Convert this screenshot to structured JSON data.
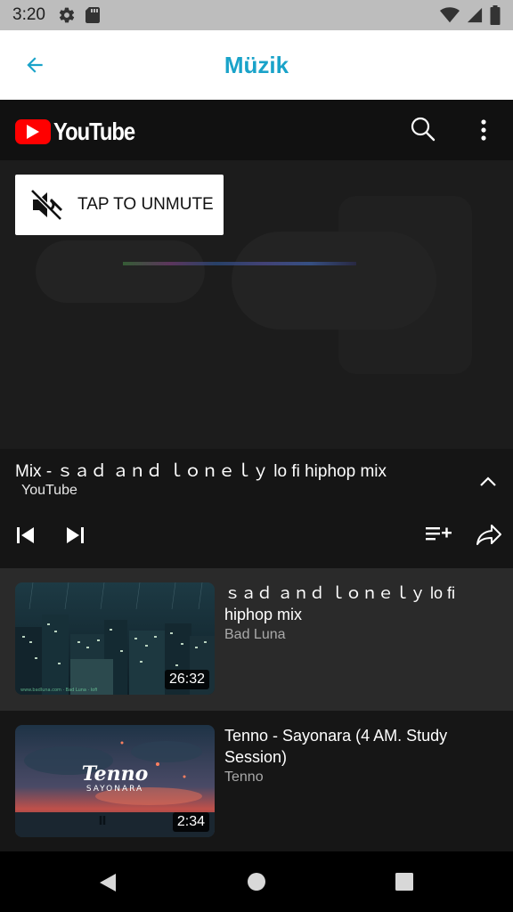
{
  "status_bar": {
    "time": "3:20",
    "left_icons": [
      "gear-icon",
      "sd-card-icon"
    ],
    "right_icons": [
      "wifi-icon",
      "signal-icon",
      "battery-icon"
    ]
  },
  "app_bar": {
    "title": "Müzik",
    "back_icon": "arrow-left-icon",
    "accent_color": "#1aa3c9"
  },
  "youtube_header": {
    "logo_text": "YouTube",
    "icons": [
      "search-icon",
      "more-vert-icon"
    ]
  },
  "player": {
    "unmute_label": "TAP TO UNMUTE",
    "unmute_icon": "volume-off-icon"
  },
  "now_playing": {
    "title": "Mix - ｓａｄ ａｎｄ ｌｏｎｅｌｙ lo fi hiphop mix",
    "subtitle": "YouTube",
    "controls": [
      "skip-previous-icon",
      "skip-next-icon",
      "playlist-add-icon",
      "share-icon",
      "chevron-up-icon"
    ]
  },
  "queue": [
    {
      "title": "ｓａｄ ａｎｄ ｌｏｎｅｌｙ lo fi hiphop mix",
      "author": "Bad Luna",
      "duration": "26:32",
      "thumb_watermark": "www.badluna.com · Bad Luna · lofi"
    },
    {
      "title": "Tenno - Sayonara (4 AM. Study Session)",
      "author": "Tenno",
      "duration": "2:34",
      "thumb_text_main": "Tenno",
      "thumb_text_sub": "SAYONARA"
    }
  ],
  "nav_bar": {
    "buttons": [
      "back-triangle-icon",
      "home-circle-icon",
      "recents-square-icon"
    ]
  }
}
